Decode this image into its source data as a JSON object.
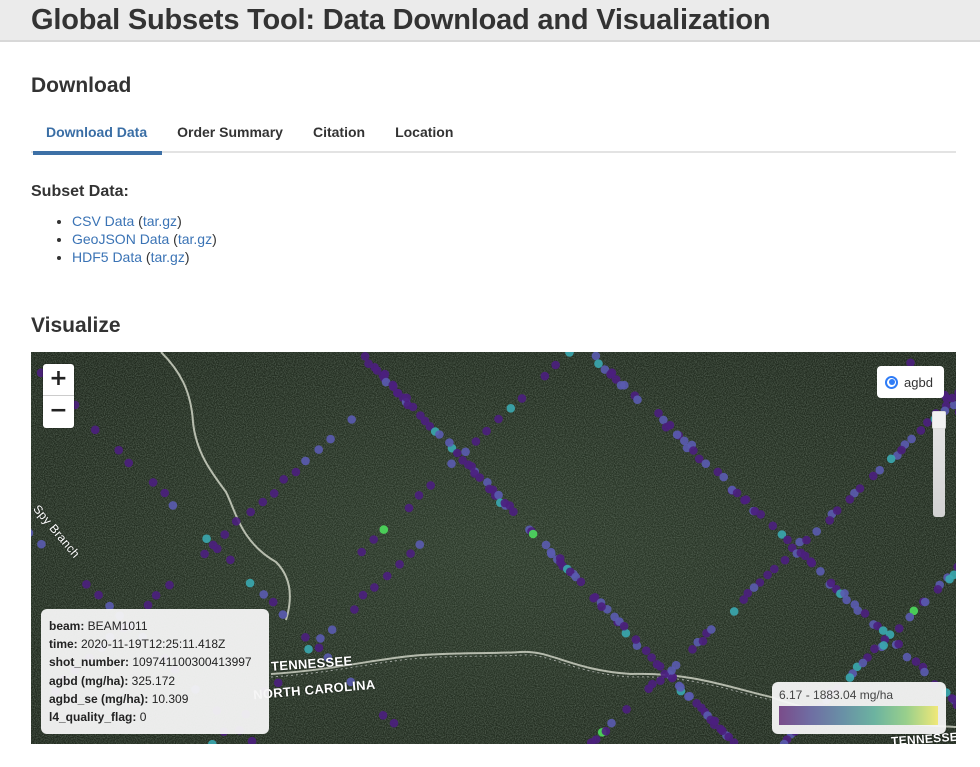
{
  "header": {
    "title": "Global Subsets Tool: Data Download and Visualization"
  },
  "download": {
    "title": "Download",
    "tabs": [
      {
        "label": "Download Data",
        "active": true
      },
      {
        "label": "Order Summary",
        "active": false
      },
      {
        "label": "Citation",
        "active": false
      },
      {
        "label": "Location",
        "active": false
      }
    ],
    "subset": {
      "title": "Subset Data:",
      "items": [
        {
          "label": "CSV Data",
          "archive": "tar.gz"
        },
        {
          "label": "GeoJSON Data",
          "archive": "tar.gz"
        },
        {
          "label": "HDF5 Data",
          "archive": "tar.gz"
        }
      ],
      "open_paren": "(",
      "close_paren": ")"
    }
  },
  "visualize": {
    "title": "Visualize",
    "zoom": {
      "in": "+",
      "out": "−"
    },
    "layer": {
      "label": "agbd",
      "selected": true
    },
    "opacity_slider": {
      "value": 1.0
    },
    "popup": {
      "fields": [
        {
          "key": "beam:",
          "value": "BEAM1011"
        },
        {
          "key": "time:",
          "value": "2020-11-19T12:25:11.418Z"
        },
        {
          "key": "shot_number:",
          "value": "109741100300413997"
        },
        {
          "key": "agbd (mg/ha):",
          "value": "325.172"
        },
        {
          "key": "agbd_se (mg/ha):",
          "value": "10.309"
        },
        {
          "key": "l4_quality_flag:",
          "value": "0"
        }
      ]
    },
    "legend": {
      "range": "6.17 - 1883.04 mg/ha",
      "colors": [
        "#7a4c8a",
        "#6f6ea3",
        "#6990a6",
        "#6cb3a0",
        "#98cf8c",
        "#f0e878"
      ]
    },
    "map_labels": {
      "stream": "Spy Branch",
      "state_north": "TENNESSEE",
      "state_south": "NORTH CAROLINA",
      "state_north_2": "TENNESSE"
    },
    "colors": {
      "low": "#4b1f7e",
      "mid": "#5a5bb0",
      "high": "#3aa8b0",
      "peak": "#4ddc5c"
    }
  }
}
